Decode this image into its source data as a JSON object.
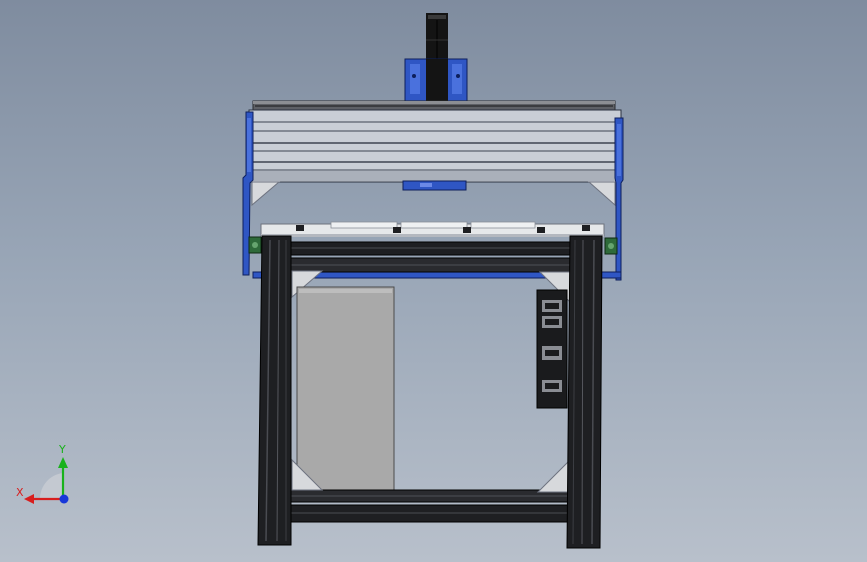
{
  "viewport": {
    "background_top": "#7f8c9f",
    "background_bottom": "#b8c0cb"
  },
  "model": {
    "colors": {
      "gantry_blue": "#2f56c4",
      "extrusion_grey": "#c9ced6",
      "frame_black": "#1e1f22",
      "panel_grey": "#a9a9a9",
      "table_top": "#e6e8ea",
      "gusset": "#d7d9dc"
    }
  },
  "triad": {
    "x_label": "X",
    "y_label": "Y",
    "x_color": "#d81e1e",
    "y_color": "#19b21b",
    "z_color": "#1737d9"
  }
}
